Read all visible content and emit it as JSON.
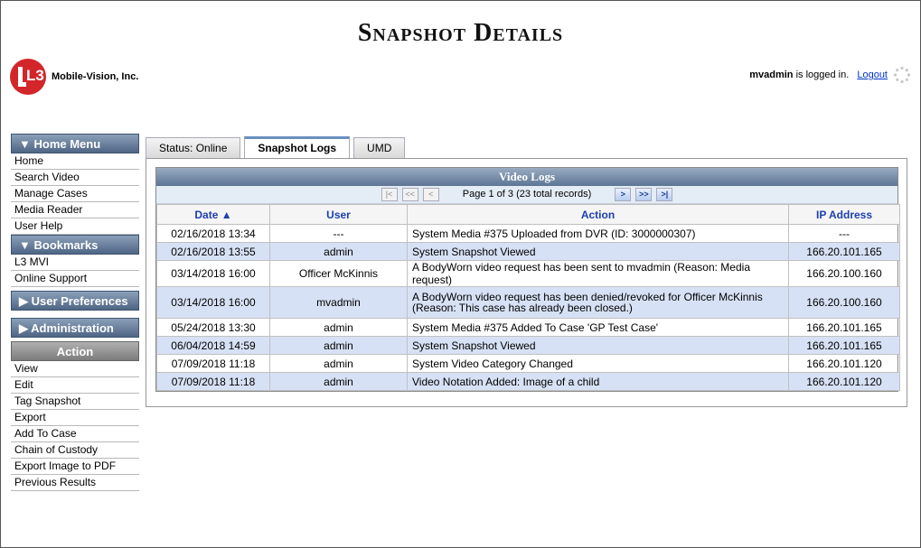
{
  "page": {
    "title": "Snapshot Details"
  },
  "brand": {
    "logo_text": "L3",
    "company": "Mobile-Vision, Inc."
  },
  "login": {
    "user": "mvadmin",
    "suffix": "is logged in.",
    "logout": "Logout"
  },
  "sidebar": {
    "home_menu": "Home Menu",
    "home_items": [
      "Home",
      "Search Video",
      "Manage Cases",
      "Media Reader",
      "User Help"
    ],
    "bookmarks": "Bookmarks",
    "bookmark_items": [
      "L3 MVI",
      "Online Support"
    ],
    "user_prefs": "User Preferences",
    "administration": "Administration",
    "action": "Action",
    "action_items": [
      "View",
      "Edit",
      "Tag Snapshot",
      "Export",
      "Add To Case",
      "Chain of Custody",
      "Export Image to PDF",
      "Previous Results"
    ]
  },
  "tabs": [
    "Status: Online",
    "Snapshot Logs",
    "UMD"
  ],
  "active_tab": "Snapshot Logs",
  "grid": {
    "title": "Video Logs",
    "pager_text": "Page 1 of 3 (23 total records)",
    "columns": [
      "Date ▲",
      "User",
      "Action",
      "IP Address"
    ],
    "rows": [
      [
        "02/16/2018 13:34",
        "---",
        "System Media #375 Uploaded from DVR (ID: 3000000307)",
        "---"
      ],
      [
        "02/16/2018 13:55",
        "admin",
        "System Snapshot Viewed",
        "166.20.101.165"
      ],
      [
        "03/14/2018 16:00",
        "Officer McKinnis",
        "A BodyWorn video request has been sent to mvadmin (Reason: Media request)",
        "166.20.100.160"
      ],
      [
        "03/14/2018 16:00",
        "mvadmin",
        "A BodyWorn video request has been denied/revoked for Officer McKinnis (Reason: This case has already been closed.)",
        "166.20.100.160"
      ],
      [
        "05/24/2018 13:30",
        "admin",
        "System Media #375 Added To Case 'GP Test Case'",
        "166.20.101.165"
      ],
      [
        "06/04/2018 14:59",
        "admin",
        "System Snapshot Viewed",
        "166.20.101.165"
      ],
      [
        "07/09/2018 11:18",
        "admin",
        "System Video Category Changed",
        "166.20.101.120"
      ],
      [
        "07/09/2018 11:18",
        "admin",
        "Video Notation Added: Image of a child",
        "166.20.101.120"
      ]
    ]
  }
}
